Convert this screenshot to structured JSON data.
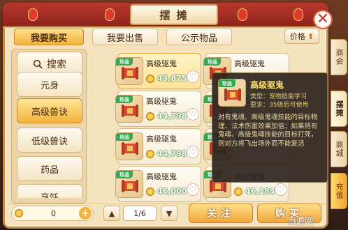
{
  "window": {
    "title": "摆 摊",
    "close_glyph": "✕"
  },
  "tabs": [
    {
      "label": "我要购买",
      "active": true
    },
    {
      "label": "我要出售",
      "active": false
    },
    {
      "label": "公示物品",
      "active": false
    }
  ],
  "sort": {
    "label": "价格",
    "arrow": "⬆"
  },
  "search": {
    "label": "搜索",
    "icon": "search-icon"
  },
  "categories": [
    {
      "label": "元身",
      "active": false
    },
    {
      "label": "高级兽诀",
      "active": true
    },
    {
      "label": "低级兽诀",
      "active": false
    },
    {
      "label": "药品",
      "active": false
    },
    {
      "label": "烹饪",
      "active": false
    }
  ],
  "items": [
    {
      "badge": "珍品",
      "name": "高级驱鬼",
      "price": "43,875",
      "selected": true
    },
    {
      "badge": "珍品",
      "name": "高级驱鬼",
      "price": "",
      "selected": false
    },
    {
      "badge": "珍品",
      "name": "高级驱鬼",
      "price": "44,798",
      "selected": false
    },
    {
      "badge": "珍品",
      "name": "高级驱鬼",
      "price": "",
      "selected": false
    },
    {
      "badge": "珍品",
      "name": "高级驱鬼",
      "price": "44,798",
      "selected": false
    },
    {
      "badge": "珍品",
      "name": "高级驱鬼",
      "price": "",
      "selected": false
    },
    {
      "badge": "珍品",
      "name": "高级驱鬼",
      "price": "46,000",
      "selected": false
    },
    {
      "badge": "珍品",
      "name": "高级驱鬼",
      "price": "46,184",
      "selected": false
    }
  ],
  "tooltip": {
    "badge": "珍品",
    "title": "高级驱鬼",
    "type_line": "类型：宠物技能学习",
    "req_line": "要求：35级后可使用",
    "description": "对有鬼魂、高级鬼魂技能的目标物理、法术伤害效果加倍；如果将有鬼魂、高级鬼魂技能的目标打死，则对方将飞出场外而不能复活"
  },
  "side_tabs": [
    {
      "label": "商会",
      "active": false
    },
    {
      "label": "摆摊",
      "active": true
    },
    {
      "label": "商城",
      "active": false
    },
    {
      "label": "充值",
      "active": false
    }
  ],
  "bottom": {
    "money": "0",
    "add_glyph": "+",
    "prev_glyph": "▲",
    "next_glyph": "▼",
    "page": "1/6",
    "follow_label": "关注",
    "buy_label": "购买"
  },
  "watermark": "当游网",
  "colors": {
    "accent": "#f3b33c",
    "price_green": "#2e7d32",
    "badge_green": "#34a853",
    "title_red": "#8f241c"
  }
}
